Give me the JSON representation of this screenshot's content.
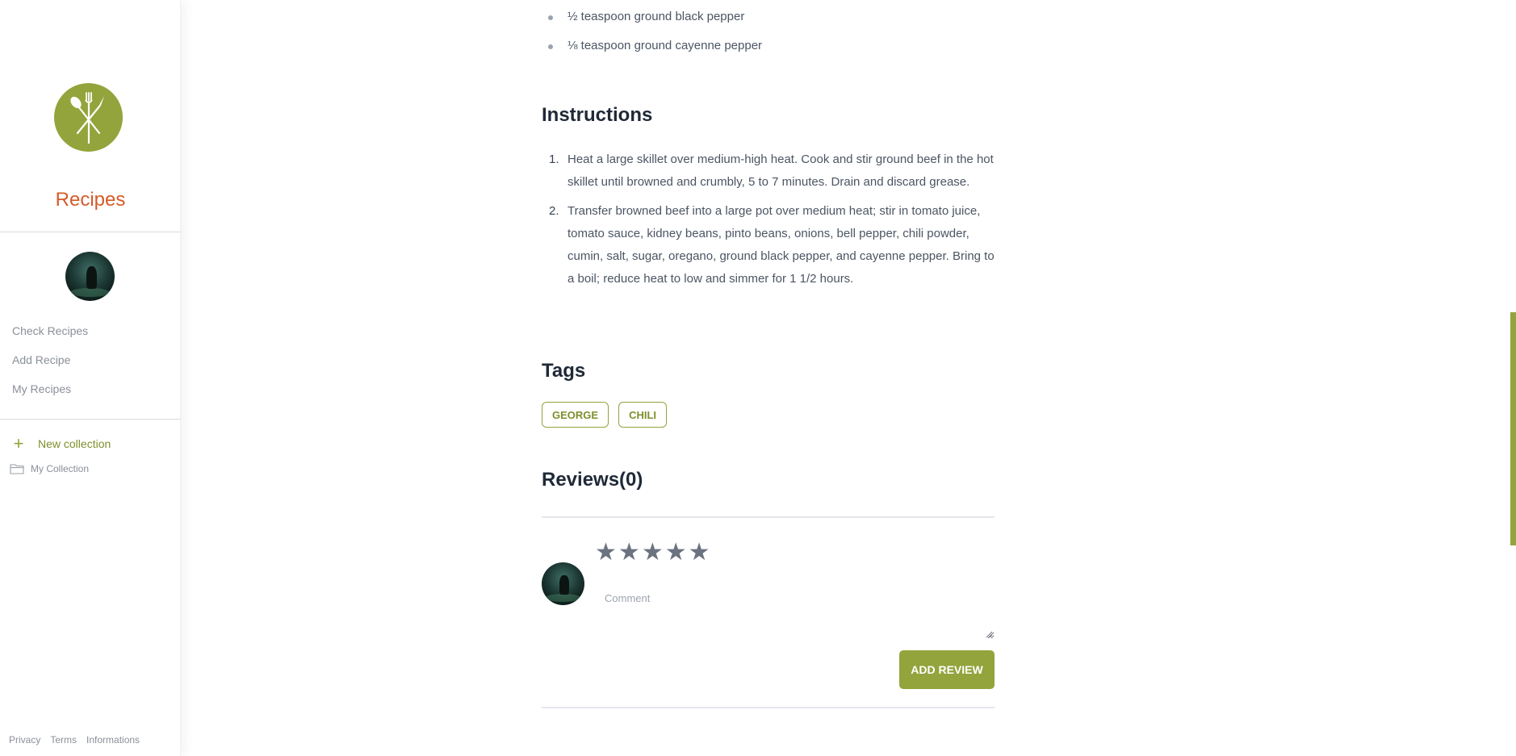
{
  "sidebar": {
    "app_title": "Recipes",
    "nav": [
      {
        "label": "Check Recipes"
      },
      {
        "label": "Add Recipe"
      },
      {
        "label": "My Recipes"
      }
    ],
    "new_collection_label": "New collection",
    "collections": [
      {
        "label": "My Collection"
      }
    ],
    "footer": [
      {
        "label": "Privacy"
      },
      {
        "label": "Terms"
      },
      {
        "label": "Informations"
      }
    ]
  },
  "recipe": {
    "ingredients": [
      "½ teaspoon ground black pepper",
      "⅛ teaspoon ground cayenne pepper"
    ],
    "instructions_heading": "Instructions",
    "instructions": [
      {
        "num": "1.",
        "text": "Heat a large skillet over medium-high heat. Cook and stir ground beef in the hot skillet until browned and crumbly, 5 to 7 minutes. Drain and discard grease."
      },
      {
        "num": "2.",
        "text": "Transfer browned beef into a large pot over medium heat; stir in tomato juice, tomato sauce, kidney beans, pinto beans, onions, bell pepper, chili powder, cumin, salt, sugar, oregano, ground black pepper, and cayenne pepper. Bring to a boil; reduce heat to low and simmer for 1 1/2 hours."
      }
    ],
    "tags_heading": "Tags",
    "tags": [
      "GEORGE",
      "CHILI"
    ],
    "reviews_heading": "Reviews(0)"
  },
  "review_form": {
    "rating_stars": 5,
    "star_glyph": "★",
    "comment_placeholder": "Comment",
    "comment_value": "",
    "submit_label": "ADD REVIEW"
  },
  "colors": {
    "accent": "#93a43c",
    "brand_title": "#d65a2a"
  }
}
